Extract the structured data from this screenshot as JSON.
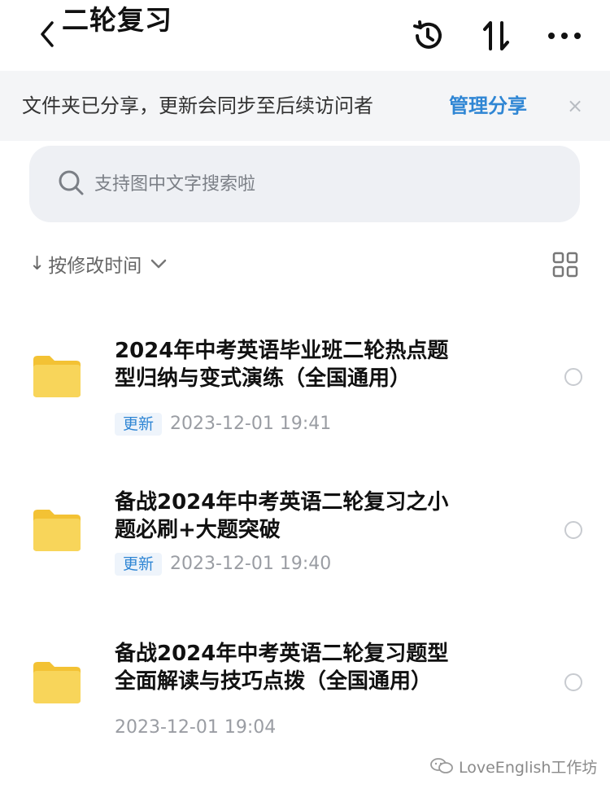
{
  "header": {
    "title": "二轮复习",
    "back_icon": "chevron-left-icon",
    "history_icon": "history-icon",
    "sort_icon": "sort-arrows-icon",
    "more_icon": "more-icon"
  },
  "banner": {
    "text": "文件夹已分享，更新会同步至后续访问者",
    "link_label": "管理分享",
    "close_label": "×"
  },
  "search": {
    "placeholder": "支持图中文字搜索啦",
    "value": ""
  },
  "sort": {
    "arrow": "↓",
    "label": "按修改时间",
    "chevron": "⌄"
  },
  "items": [
    {
      "title_line1": "2024年中考英语毕业班二轮热点题",
      "title_line2": "型归纳与变式演练（全国通用）",
      "badge": "更新",
      "date": "2023-12-01 19:41"
    },
    {
      "title_line1": "备战2024年中考英语二轮复习之小",
      "title_line2": "题必刷+大题突破",
      "badge": "更新",
      "date": "2023-12-01 19:40"
    },
    {
      "title_line1": "备战2024年中考英语二轮复习题型",
      "title_line2": "全面解读与技巧点拨（全国通用）",
      "badge": "",
      "date": "2023-12-01 19:04"
    }
  ],
  "watermark": {
    "text": "LoveEnglish工作坊"
  },
  "colors": {
    "accent": "#2f86d4",
    "folder": "#f7cf4a",
    "banner_bg": "#f4f5f7",
    "search_bg": "#eef0f4"
  }
}
